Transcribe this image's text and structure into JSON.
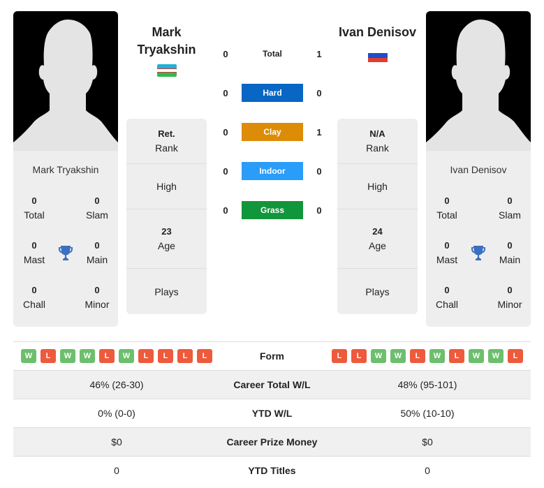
{
  "colors": {
    "hard": "#0866c4",
    "clay": "#dd8c07",
    "indoor": "#2a9cfa",
    "grass": "#12963b",
    "win": "#6cbf6c",
    "loss": "#ee5a3c",
    "trophy": "#3b6fbf"
  },
  "player1": {
    "header_name_line1": "Mark",
    "header_name_line2": "Tryakshin",
    "card_name": "Mark Tryakshin",
    "flag": "uzbekistan-flag",
    "titles": {
      "total": "0",
      "total_label": "Total",
      "slam": "0",
      "slam_label": "Slam",
      "mast": "0",
      "mast_label": "Mast",
      "main": "0",
      "main_label": "Main",
      "chall": "0",
      "chall_label": "Chall",
      "minor": "0",
      "minor_label": "Minor"
    },
    "rank_value": "Ret.",
    "rank_label": "Rank",
    "high_label": "High",
    "age_value": "23",
    "age_label": "Age",
    "plays_label": "Plays",
    "form": [
      "W",
      "L",
      "W",
      "W",
      "L",
      "W",
      "L",
      "L",
      "L",
      "L"
    ],
    "career_wl": "46% (26-30)",
    "ytd_wl": "0% (0-0)",
    "prize_money": "$0",
    "ytd_titles": "0"
  },
  "player2": {
    "header_name": "Ivan Denisov",
    "card_name": "Ivan Denisov",
    "flag": "russia-flag",
    "titles": {
      "total": "0",
      "total_label": "Total",
      "slam": "0",
      "slam_label": "Slam",
      "mast": "0",
      "mast_label": "Mast",
      "main": "0",
      "main_label": "Main",
      "chall": "0",
      "chall_label": "Chall",
      "minor": "0",
      "minor_label": "Minor"
    },
    "rank_value": "N/A",
    "rank_label": "Rank",
    "high_label": "High",
    "age_value": "24",
    "age_label": "Age",
    "plays_label": "Plays",
    "form": [
      "L",
      "L",
      "W",
      "W",
      "L",
      "W",
      "L",
      "W",
      "W",
      "L"
    ],
    "career_wl": "48% (95-101)",
    "ytd_wl": "50% (10-10)",
    "prize_money": "$0",
    "ytd_titles": "0"
  },
  "h2h": [
    {
      "label": "Total",
      "p1": "0",
      "p2": "1"
    },
    {
      "label": "Hard",
      "p1": "0",
      "p2": "0"
    },
    {
      "label": "Clay",
      "p1": "0",
      "p2": "1"
    },
    {
      "label": "Indoor",
      "p1": "0",
      "p2": "0"
    },
    {
      "label": "Grass",
      "p1": "0",
      "p2": "0"
    }
  ],
  "stats_labels": {
    "form": "Form",
    "career_wl": "Career Total W/L",
    "ytd_wl": "YTD W/L",
    "prize_money": "Career Prize Money",
    "ytd_titles": "YTD Titles"
  }
}
